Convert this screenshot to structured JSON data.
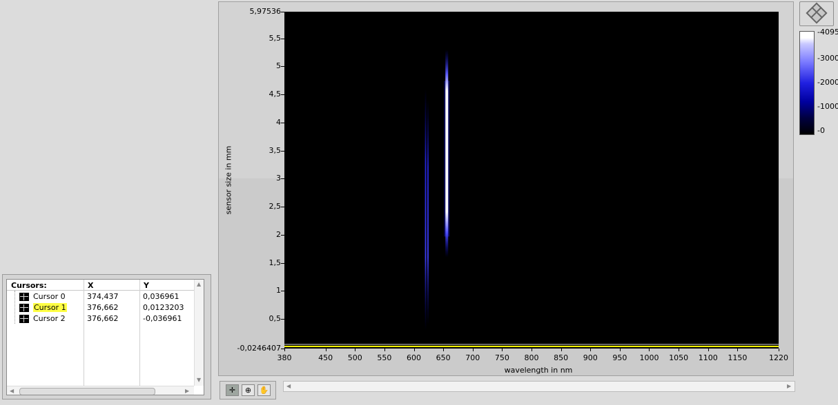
{
  "cursor_legend": {
    "headers": {
      "name": "Cursors:",
      "x": "X",
      "y": "Y"
    },
    "rows": [
      {
        "name": "Cursor 0",
        "x": "374,437",
        "y": "0,036961",
        "selected": false
      },
      {
        "name": "Cursor 1",
        "x": "376,662",
        "y": "0,0123203",
        "selected": true
      },
      {
        "name": "Cursor 2",
        "x": "376,662",
        "y": "-0,036961",
        "selected": false
      }
    ]
  },
  "graph": {
    "ylabel": "sensor size in mm",
    "xlabel": "wavelength in nm",
    "y_ticks": [
      "5,97536",
      "5,5",
      "5",
      "4,5",
      "4",
      "3,5",
      "3",
      "2,5",
      "2",
      "1,5",
      "1",
      "0,5",
      "-0,0246407"
    ],
    "y_tick_values": [
      5.97536,
      5.5,
      5,
      4.5,
      4,
      3.5,
      3,
      2.5,
      2,
      1.5,
      1,
      0.5,
      -0.0246407
    ],
    "x_ticks": [
      "380",
      "450",
      "500",
      "550",
      "600",
      "650",
      "700",
      "750",
      "800",
      "850",
      "900",
      "950",
      "1000",
      "1050",
      "1100",
      "1150",
      "1220"
    ],
    "x_tick_values": [
      380,
      450,
      500,
      550,
      600,
      650,
      700,
      750,
      800,
      850,
      900,
      950,
      1000,
      1050,
      1100,
      1150,
      1220
    ],
    "xlim": [
      380,
      1220
    ],
    "ylim": [
      -0.0246407,
      5.97536
    ],
    "background_color": "#000000",
    "cursor_line_color": "#ffff00"
  },
  "colorbar": {
    "labels": [
      "4095",
      "3000",
      "2000",
      "1000",
      "0"
    ],
    "label_values": [
      4095,
      3000,
      2000,
      1000,
      0
    ],
    "max": 4095
  },
  "chart_data": {
    "type": "heatmap",
    "xlabel": "wavelength in nm",
    "ylabel": "sensor size in mm",
    "xlim": [
      380,
      1220
    ],
    "ylim": [
      -0.0246407,
      5.97536
    ],
    "zlim": [
      0,
      4095
    ],
    "bands": [
      {
        "x": 620,
        "y_from": 0.3,
        "y_to": 4.6,
        "intensity": 900
      },
      {
        "x": 624,
        "y_from": 0.4,
        "y_to": 4.4,
        "intensity": 1200
      },
      {
        "x": 656,
        "y_from": 1.6,
        "y_to": 5.3,
        "intensity": 4095
      }
    ],
    "cursor_y": 0.0123203
  },
  "palette": {
    "buttons": [
      {
        "icon": "crosshair-icon",
        "glyph": "✛",
        "active": true
      },
      {
        "icon": "zoom-icon",
        "glyph": "⊕",
        "active": false
      },
      {
        "icon": "pan-hand-icon",
        "glyph": "✋",
        "active": false
      }
    ]
  },
  "cursor_mode_button": {
    "icon": "cursor-diamond-icon"
  }
}
